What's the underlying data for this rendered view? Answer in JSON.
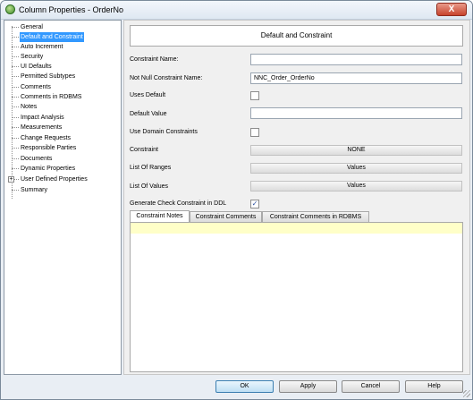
{
  "window": {
    "title": "Column Properties - OrderNo",
    "close_label": "X"
  },
  "tree": {
    "items": [
      {
        "label": "General",
        "selected": false
      },
      {
        "label": "Default and Constraint",
        "selected": true
      },
      {
        "label": "Auto Increment",
        "selected": false
      },
      {
        "label": "Security",
        "selected": false
      },
      {
        "label": "UI Defaults",
        "selected": false
      },
      {
        "label": "Permitted Subtypes",
        "selected": false
      },
      {
        "label": "Comments",
        "selected": false
      },
      {
        "label": "Comments in RDBMS",
        "selected": false
      },
      {
        "label": "Notes",
        "selected": false
      },
      {
        "label": "Impact Analysis",
        "selected": false
      },
      {
        "label": "Measurements",
        "selected": false
      },
      {
        "label": "Change Requests",
        "selected": false
      },
      {
        "label": "Responsible Parties",
        "selected": false
      },
      {
        "label": "Documents",
        "selected": false
      },
      {
        "label": "Dynamic Properties",
        "selected": false
      },
      {
        "label": "User Defined Properties",
        "selected": false,
        "expandable": true
      },
      {
        "label": "Summary",
        "selected": false
      }
    ]
  },
  "form": {
    "header": "Default and Constraint",
    "constraint_name": {
      "label": "Constraint Name:",
      "value": ""
    },
    "not_null_name": {
      "label": "Not Null Constraint Name:",
      "value": "NNC_Order_OrderNo"
    },
    "uses_default": {
      "label": "Uses Default",
      "mark": ""
    },
    "default_value": {
      "label": "Default Value",
      "value": ""
    },
    "use_domain": {
      "label": "Use Domain Constraints",
      "mark": ""
    },
    "constraint": {
      "label": "Constraint",
      "button": "NONE"
    },
    "ranges": {
      "label": "List Of Ranges",
      "button": "Values"
    },
    "values": {
      "label": "List Of Values",
      "button": "Values"
    },
    "check_ddl": {
      "label": "Generate Check Constraint in DDL",
      "mark": "✓"
    }
  },
  "tabs": [
    "Constraint Notes",
    "Constraint Comments",
    "Constraint Comments in RDBMS"
  ],
  "buttons": {
    "ok": "OK",
    "apply": "Apply",
    "cancel": "Cancel",
    "help": "Help"
  }
}
